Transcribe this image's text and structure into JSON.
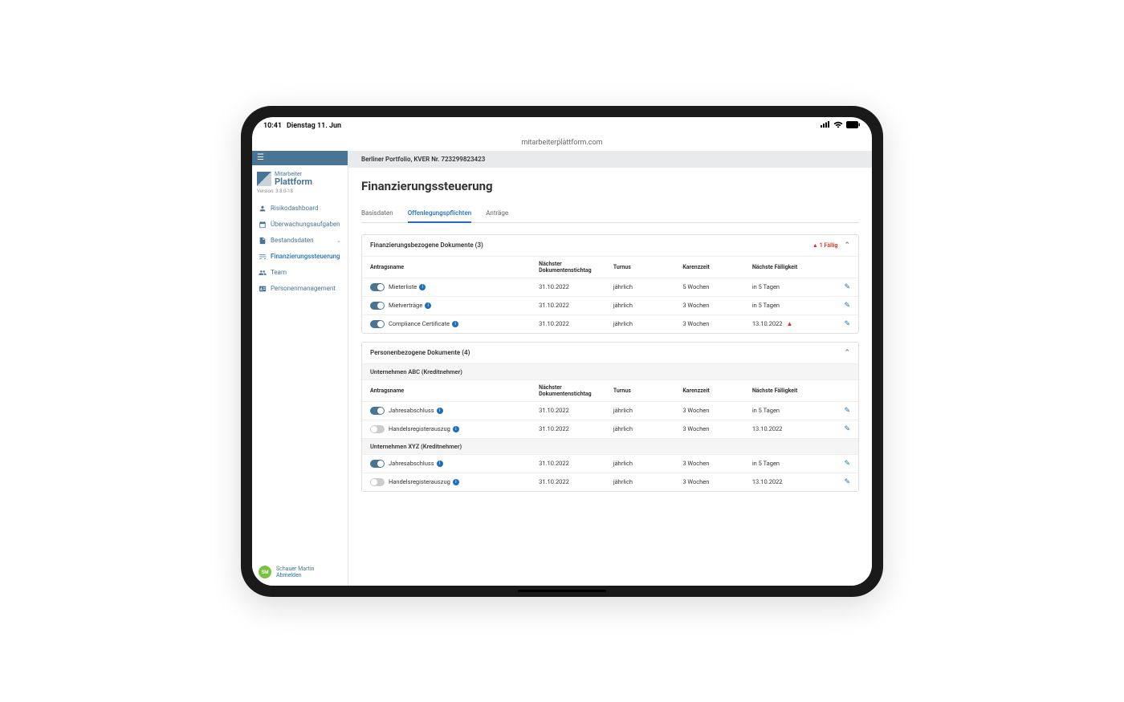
{
  "statusbar": {
    "time": "10:41",
    "date": "Dienstag 11. Jun"
  },
  "url": "mitarbeiterplattform.com",
  "logo": {
    "line1": "Mitarbeiter",
    "line2": "Plattform",
    "version": "Version: 3.8.0-18"
  },
  "nav": [
    {
      "label": "Risikodashboard",
      "icon": "user"
    },
    {
      "label": "Überwachungsaufgaben",
      "icon": "calendar"
    },
    {
      "label": "Bestandsdaten",
      "icon": "doc",
      "expandable": true
    },
    {
      "label": "Finanzierungssteuerung",
      "icon": "sliders",
      "active": true
    },
    {
      "label": "Team",
      "icon": "people"
    },
    {
      "label": "Personenmanagement",
      "icon": "id"
    }
  ],
  "user": {
    "initials": "SM",
    "name": "Schauer Martin",
    "logout": "Abmelden"
  },
  "breadcrumb": "Berliner Portfolio, KVER Nr. 723299823423",
  "pageTitle": "Finanzierungssteuerung",
  "tabs": [
    {
      "label": "Basisdaten"
    },
    {
      "label": "Offenlegungspflichten",
      "active": true
    },
    {
      "label": "Anträge"
    }
  ],
  "card1": {
    "title": "Finanzierungsbezogene Dokumente (3)",
    "dueBadge": "1 Fällig",
    "headers": {
      "name": "Antragsname",
      "date": "Nächster Dokumentenstichtag",
      "turnus": "Turnus",
      "karenz": "Karenzzeit",
      "due": "Nächste Fälligkeit"
    },
    "rows": [
      {
        "on": true,
        "name": "Mieterliste",
        "date": "31.10.2022",
        "turnus": "jährlich",
        "karenz": "5 Wochen",
        "due": "in 5 Tagen"
      },
      {
        "on": true,
        "name": "Mietverträge",
        "date": "31.10.2022",
        "turnus": "jährlich",
        "karenz": "3 Wochen",
        "due": "in 5 Tagen"
      },
      {
        "on": true,
        "name": "Compliance Certificate",
        "date": "31.10.2022",
        "turnus": "jährlich",
        "karenz": "3 Wochen",
        "due": "13.10.2022",
        "overdue": true
      }
    ]
  },
  "card2": {
    "title": "Personenbezogene Dokumente (4)",
    "headers": {
      "name": "Antragsname",
      "date": "Nächster Dokumentenstichtag",
      "turnus": "Turnus",
      "karenz": "Karenzzeit",
      "due": "Nächste Fälligkeit"
    },
    "groups": [
      {
        "label": "Unternehmen ABC (Kreditnehmer)",
        "rows": [
          {
            "on": true,
            "name": "Jahresabschluss",
            "date": "31.10.2022",
            "turnus": "jährlich",
            "karenz": "3 Wochen",
            "due": "in 5 Tagen"
          },
          {
            "on": false,
            "name": "Handelsregisterauszug",
            "date": "31.10.2022",
            "turnus": "jährlich",
            "karenz": "3 Wochen",
            "due": "13.10.2022"
          }
        ]
      },
      {
        "label": "Unternehmen XYZ (Kreditnehmer)",
        "rows": [
          {
            "on": true,
            "name": "Jahresabschluss",
            "date": "31.10.2022",
            "turnus": "jährlich",
            "karenz": "3 Wochen",
            "due": "in 5 Tagen"
          },
          {
            "on": false,
            "name": "Handelsregisterauszug",
            "date": "31.10.2022",
            "turnus": "jährlich",
            "karenz": "3 Wochen",
            "due": "13.10.2022"
          }
        ]
      }
    ]
  }
}
